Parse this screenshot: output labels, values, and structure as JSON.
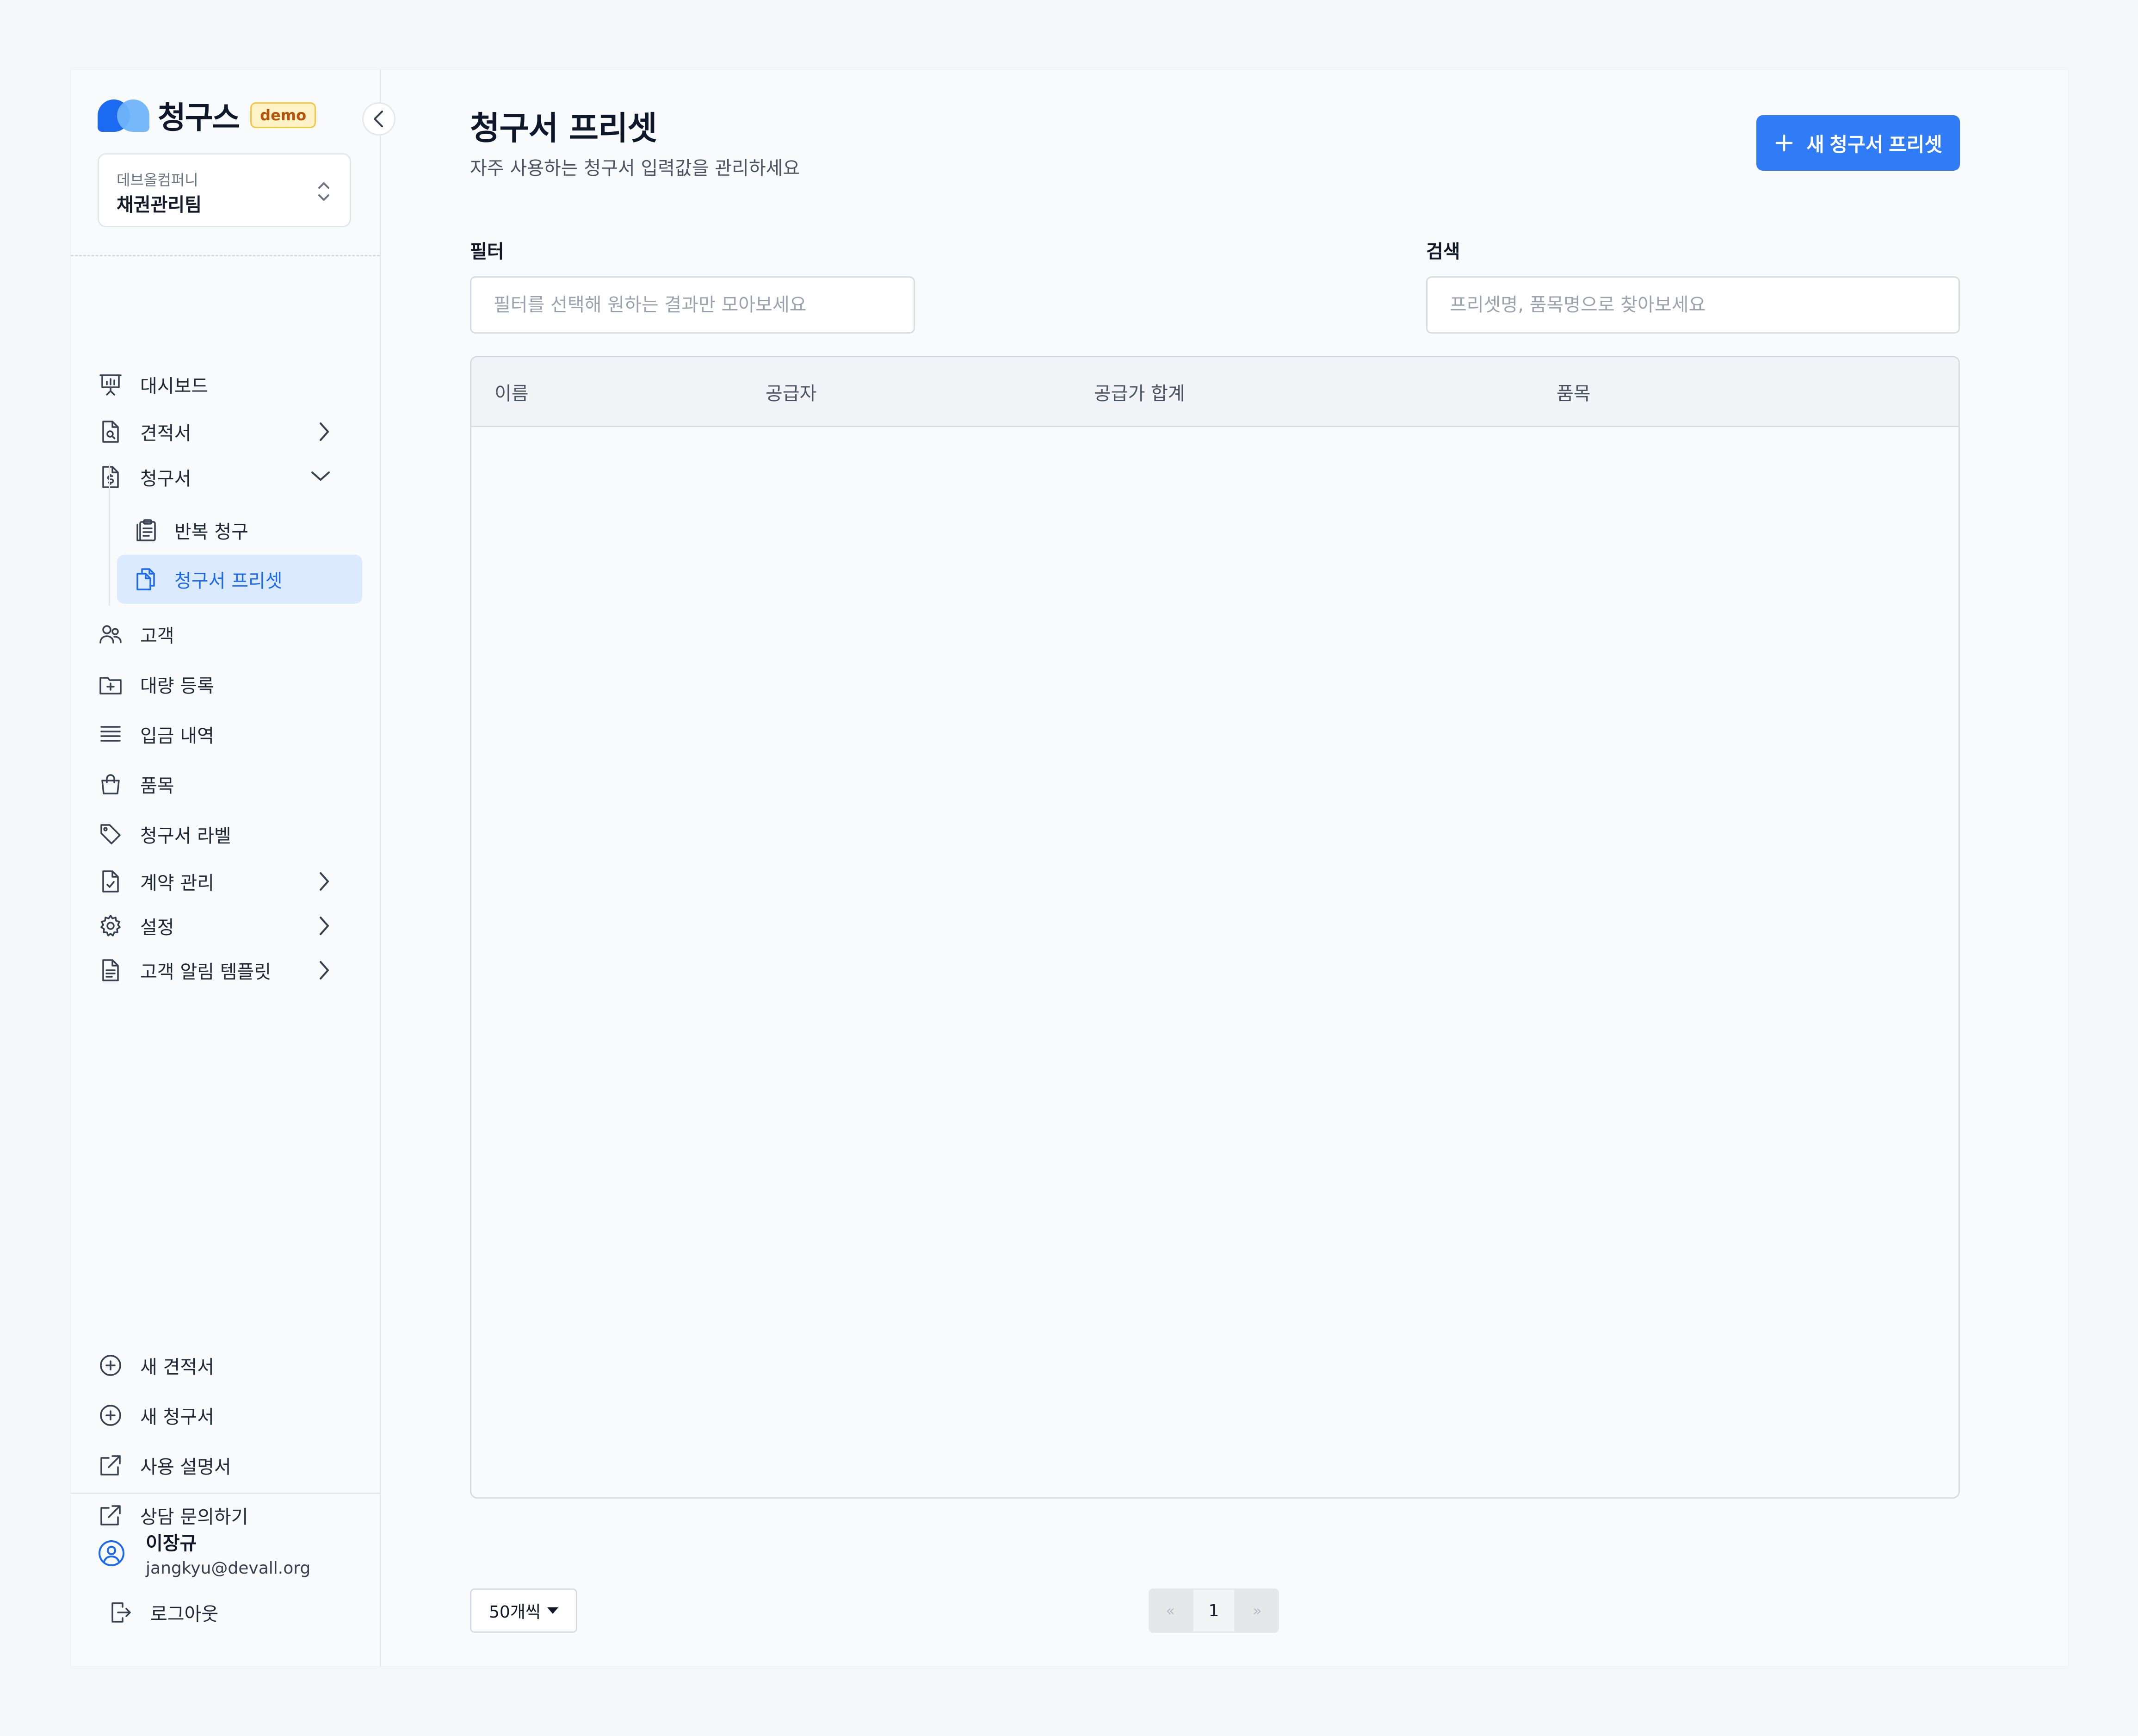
{
  "app": {
    "logo_text": "청구스",
    "badge": "demo"
  },
  "org": {
    "company": "데브올컴퍼니",
    "team": "채권관리팀"
  },
  "nav": {
    "dashboard": "대시보드",
    "quotes": "견적서",
    "invoices": "청구서",
    "recurring": "반복 청구",
    "invoice_presets": "청구서 프리셋",
    "customers": "고객",
    "bulk_register": "대량 등록",
    "deposits": "입금 내역",
    "products": "품목",
    "invoice_labels": "청구서 라벨",
    "contracts": "계약 관리",
    "settings": "설정",
    "notify_templates": "고객 알림 템플릿"
  },
  "quick": {
    "new_quote": "새 견적서",
    "new_invoice": "새 청구서",
    "manual": "사용 설명서",
    "contact": "상담 문의하기"
  },
  "user": {
    "name": "이장규",
    "email": "jangkyu@devall.org",
    "logout": "로그아웃"
  },
  "page": {
    "title": "청구서 프리셋",
    "subtitle": "자주 사용하는 청구서 입력값을 관리하세요",
    "new_button": "새 청구서 프리셋"
  },
  "filter": {
    "label": "필터",
    "placeholder": "필터를 선택해 원하는 결과만 모아보세요"
  },
  "search": {
    "label": "검색",
    "placeholder": "프리셋명, 품목명으로 찾아보세요"
  },
  "table": {
    "columns": [
      "이름",
      "공급자",
      "공급가 합계",
      "품목"
    ]
  },
  "pagination": {
    "page_size": "50개씩",
    "first": "«",
    "current": "1",
    "last": "»"
  },
  "colors": {
    "accent": "#2f7cf6",
    "active_bg": "#dbeafe",
    "badge_bg": "#fef3c7"
  }
}
